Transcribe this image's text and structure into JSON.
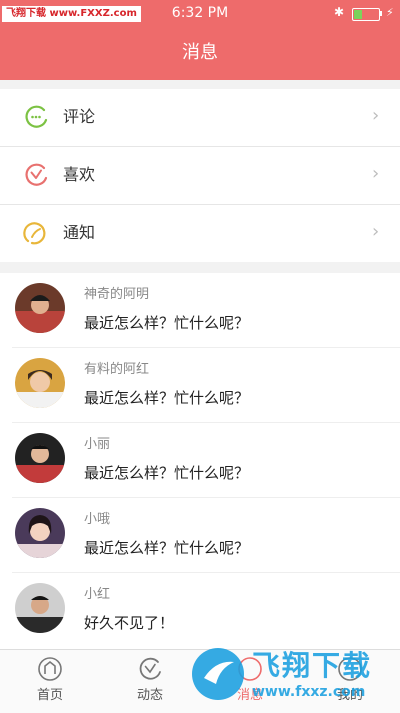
{
  "status_bar": {
    "watermark": "飞翔下载 www.FXXZ.com",
    "time": "6:32 PM",
    "battery_level": 0.35
  },
  "header": {
    "title": "消息"
  },
  "menu": [
    {
      "label": "评论",
      "icon": "comment-icon",
      "color": "#7cc243"
    },
    {
      "label": "喜欢",
      "icon": "heart-icon",
      "color": "#e8716f"
    },
    {
      "label": "通知",
      "icon": "notification-icon",
      "color": "#e8b63a"
    }
  ],
  "messages": [
    {
      "name": "神奇的阿明",
      "text": "最近怎么样？忙什么呢？",
      "avatar": "avatar-photo"
    },
    {
      "name": "有料的阿红",
      "text": "最近怎么样？忙什么呢？",
      "avatar": "avatar-photo"
    },
    {
      "name": "小丽",
      "text": "最近怎么样？忙什么呢？",
      "avatar": "avatar-photo"
    },
    {
      "name": "小哦",
      "text": "最近怎么样？忙什么呢？",
      "avatar": "avatar-photo"
    },
    {
      "name": "小红",
      "text": "好久不见了！",
      "avatar": "avatar-photo"
    }
  ],
  "tabbar": [
    {
      "label": "首页",
      "icon": "home-icon",
      "active": false
    },
    {
      "label": "动态",
      "icon": "activity-icon",
      "active": false
    },
    {
      "label": "消息",
      "icon": "message-icon",
      "active": true
    },
    {
      "label": "我的",
      "icon": "profile-icon",
      "active": false
    }
  ],
  "watermark_logo": {
    "title": "飞翔下载",
    "url": "www.fxxz.com"
  },
  "colors": {
    "accent": "#ee6b6b"
  }
}
